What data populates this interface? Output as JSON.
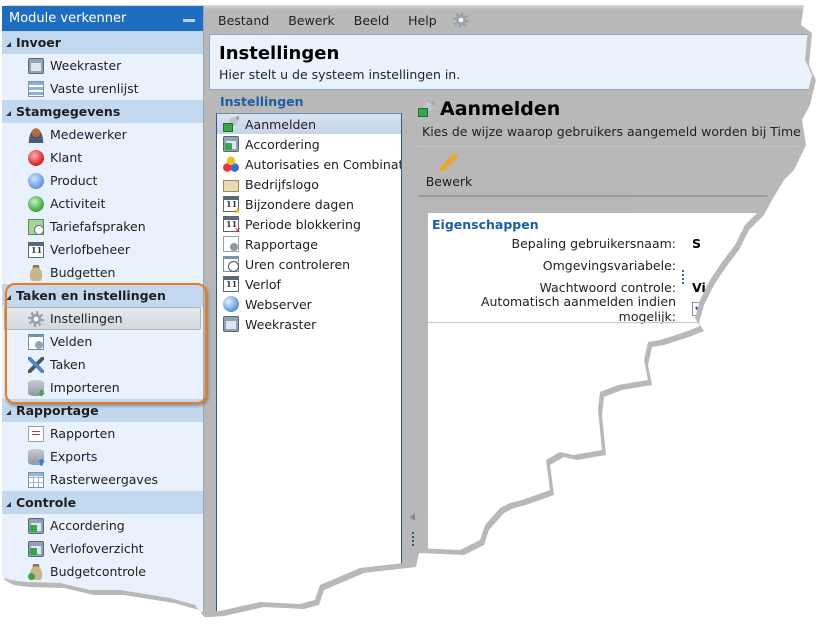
{
  "sidebar": {
    "title": "Module verkenner",
    "groups": [
      {
        "label": "Invoer",
        "items": [
          {
            "label": "Weekraster",
            "icon": "weekraster-icon"
          },
          {
            "label": "Vaste urenlijst",
            "icon": "grid-list-icon"
          }
        ]
      },
      {
        "label": "Stamgegevens",
        "items": [
          {
            "label": "Medewerker",
            "icon": "person-icon"
          },
          {
            "label": "Klant",
            "icon": "red-ball-icon"
          },
          {
            "label": "Product",
            "icon": "blue-ball-icon"
          },
          {
            "label": "Activiteit",
            "icon": "green-ball-icon"
          },
          {
            "label": "Tariefafspraken",
            "icon": "tariff-clock-icon"
          },
          {
            "label": "Verlofbeheer",
            "icon": "calendar-icon"
          },
          {
            "label": "Budgetten",
            "icon": "money-bag-icon"
          }
        ]
      },
      {
        "label": "Taken en instellingen",
        "items": [
          {
            "label": "Instellingen",
            "icon": "gear-icon",
            "selected": true
          },
          {
            "label": "Velden",
            "icon": "fields-icon"
          },
          {
            "label": "Taken",
            "icon": "tools-icon"
          },
          {
            "label": "Importeren",
            "icon": "database-import-icon"
          }
        ]
      },
      {
        "label": "Rapportage",
        "items": [
          {
            "label": "Rapporten",
            "icon": "report-doc-icon"
          },
          {
            "label": "Exports",
            "icon": "database-export-icon"
          },
          {
            "label": "Rasterweergaves",
            "icon": "table-icon"
          }
        ]
      },
      {
        "label": "Controle",
        "items": [
          {
            "label": "Accordering",
            "icon": "approval-calendar-icon"
          },
          {
            "label": "Verlofoverzicht",
            "icon": "approval-calendar-icon"
          },
          {
            "label": "Budgetcontrole",
            "icon": "money-bag-check-icon"
          }
        ]
      }
    ]
  },
  "menu": {
    "items": [
      "Bestand",
      "Bewerk",
      "Beeld",
      "Help"
    ],
    "settings_icon": "gear-icon"
  },
  "header": {
    "title": "Instellingen",
    "subtitle": "Hier stelt u de systeem instellingen in."
  },
  "settings_list": {
    "title": "Instellingen",
    "items": [
      {
        "label": "Aanmelden",
        "icon": "key-check-icon",
        "selected": true
      },
      {
        "label": "Accordering",
        "icon": "approval-calendar-icon"
      },
      {
        "label": "Autorisaties en Combinaties",
        "icon": "group-balls-icon"
      },
      {
        "label": "Bedrijfslogo",
        "icon": "logo-image-icon"
      },
      {
        "label": "Bijzondere dagen",
        "icon": "calendar-star-icon"
      },
      {
        "label": "Periode blokkering",
        "icon": "calendar-block-icon"
      },
      {
        "label": "Rapportage",
        "icon": "report-gear-icon"
      },
      {
        "label": "Uren controleren",
        "icon": "calendar-clock-icon"
      },
      {
        "label": "Verlof",
        "icon": "calendar-icon"
      },
      {
        "label": "Webserver",
        "icon": "globe-icon"
      },
      {
        "label": "Weekraster",
        "icon": "weekraster-icon"
      }
    ]
  },
  "detail": {
    "title": "Aanmelden",
    "description": "Kies de wijze waarop gebruikers aangemeld worden bij TimeWr",
    "edit_label": "Bewerk",
    "properties": {
      "title": "Eigenschappen",
      "rows": [
        {
          "label": "Bepaling gebruikersnaam:",
          "value": "S"
        },
        {
          "label": "Omgevingsvariabele:",
          "value": ""
        },
        {
          "label": "Wachtwoord controle:",
          "value": "Via"
        },
        {
          "label": "Automatisch aanmelden indien mogelijk:",
          "checked": true
        }
      ]
    }
  },
  "colors": {
    "accent": "#1e6dbf",
    "group_bg": "#c2d8ee",
    "sidebar_bg": "#e9f2fc",
    "highlight": "#ef7a1a",
    "section_title": "#1b5ea5"
  }
}
